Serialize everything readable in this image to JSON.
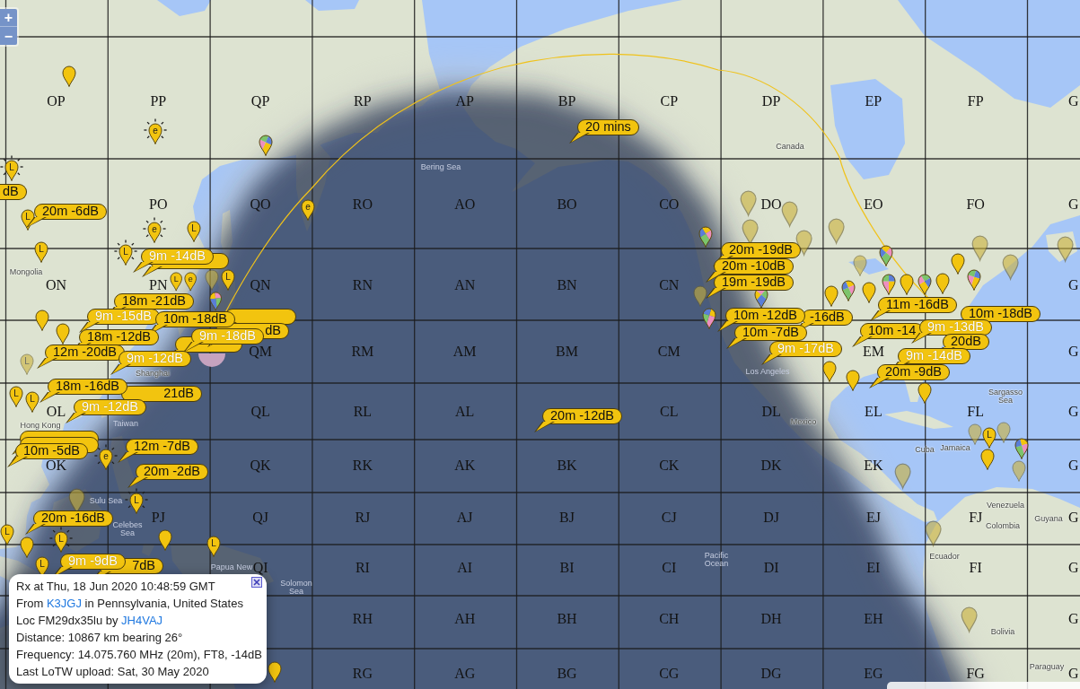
{
  "zoom_controls": [
    {
      "label": "+"
    },
    {
      "label": "−"
    }
  ],
  "grid_labels": [
    "OP",
    "PP",
    "QP",
    "RP",
    "AP",
    "BP",
    "CP",
    "DP",
    "EP",
    "FP",
    "G",
    "PO",
    "QO",
    "RO",
    "AO",
    "BO",
    "CO",
    "DO",
    "EO",
    "FO",
    "G",
    "ON",
    "PN",
    "QN",
    "RN",
    "AN",
    "BN",
    "CN",
    "G",
    "QM",
    "RM",
    "AM",
    "BM",
    "CM",
    "EM",
    "G",
    "OL",
    "QL",
    "RL",
    "AL",
    "CL",
    "DL",
    "EL",
    "FL",
    "G",
    "OK",
    "QK",
    "RK",
    "AK",
    "BK",
    "CK",
    "DK",
    "EK",
    "G",
    "PJ",
    "QJ",
    "RJ",
    "AJ",
    "BJ",
    "CJ",
    "DJ",
    "EJ",
    "FJ",
    "G",
    "QI",
    "RI",
    "AI",
    "BI",
    "CI",
    "DI",
    "EI",
    "FI",
    "G",
    "RH",
    "AH",
    "BH",
    "CH",
    "DH",
    "EH",
    "G",
    "RG",
    "AG",
    "BG",
    "CG",
    "DG",
    "EG",
    "FG",
    "G"
  ],
  "map_labels": [
    "Canada",
    "Bering Sea",
    "Mongolia",
    "Shanghai",
    "Los Angeles",
    "Sargasso Sea",
    "Hong Kong",
    "Taiwan",
    "Mexico",
    "Cuba",
    "Jamaica",
    "Sulu Sea",
    "Venezuela",
    "Celebes Sea",
    "Colombia",
    "Guyana",
    "Pacific Ocean",
    "Ecuador",
    "Papua New",
    "Solomon Sea",
    "Bolivia",
    "Paraguay"
  ],
  "markers": [
    {
      "kind": "pin",
      "faded": false
    },
    {
      "kind": "sun",
      "letter": "e",
      "faded": false
    },
    {
      "kind": "pie",
      "faded": false
    },
    {
      "kind": "sun",
      "letter": "L",
      "faded": false
    },
    {
      "kind": "pin",
      "faded": true
    },
    {
      "kind": "letter",
      "letter": "e",
      "faded": false
    },
    {
      "kind": "pin",
      "faded": true
    },
    {
      "kind": "letter",
      "letter": "L",
      "faded": false
    },
    {
      "kind": "sun",
      "letter": "e",
      "faded": false
    },
    {
      "kind": "letter",
      "letter": "L",
      "faded": false
    },
    {
      "kind": "pin",
      "faded": true
    },
    {
      "kind": "pin",
      "faded": true
    },
    {
      "kind": "pie",
      "faded": false
    },
    {
      "kind": "pin",
      "faded": true
    },
    {
      "kind": "pin",
      "faded": true
    },
    {
      "kind": "pin",
      "faded": true
    },
    {
      "kind": "letter",
      "letter": "L",
      "faded": false
    },
    {
      "kind": "sun",
      "letter": "L",
      "faded": false
    },
    {
      "kind": "pie",
      "faded": false
    },
    {
      "kind": "pin",
      "faded": true
    },
    {
      "kind": "pin",
      "faded": false
    },
    {
      "kind": "pin",
      "faded": true
    },
    {
      "kind": "letter",
      "letter": "L",
      "faded": false
    },
    {
      "kind": "letter",
      "letter": "e",
      "faded": false
    },
    {
      "kind": "pin",
      "faded": true
    },
    {
      "kind": "letter",
      "letter": "L",
      "faded": false
    },
    {
      "kind": "pin",
      "faded": false
    },
    {
      "kind": "pie",
      "faded": false
    },
    {
      "kind": "pin",
      "faded": true
    },
    {
      "kind": "pie",
      "faded": false
    },
    {
      "kind": "pin",
      "faded": false
    },
    {
      "kind": "pie",
      "faded": false
    },
    {
      "kind": "pin",
      "faded": false
    },
    {
      "kind": "pie",
      "faded": false
    },
    {
      "kind": "pie",
      "faded": false
    },
    {
      "kind": "pin",
      "faded": false
    },
    {
      "kind": "pie",
      "faded": false
    },
    {
      "kind": "pin",
      "faded": false
    },
    {
      "kind": "pie",
      "faded": false
    },
    {
      "kind": "pin",
      "faded": false
    },
    {
      "kind": "letter",
      "letter": "L",
      "faded": true
    },
    {
      "kind": "sector",
      "faded": false
    },
    {
      "kind": "pin",
      "faded": false
    },
    {
      "kind": "pin",
      "faded": false
    },
    {
      "kind": "letter",
      "letter": "L",
      "faded": false
    },
    {
      "kind": "letter",
      "letter": "L",
      "faded": false
    },
    {
      "kind": "pin",
      "faded": false
    },
    {
      "kind": "pin",
      "faded": true
    },
    {
      "kind": "letter",
      "letter": "L",
      "faded": false
    },
    {
      "kind": "pin",
      "faded": true
    },
    {
      "kind": "pie",
      "faded": false
    },
    {
      "kind": "sun",
      "letter": "e",
      "faded": false
    },
    {
      "kind": "pin",
      "faded": false
    },
    {
      "kind": "pin",
      "faded": true
    },
    {
      "kind": "pin",
      "faded": true
    },
    {
      "kind": "pin",
      "faded": true
    },
    {
      "kind": "sun",
      "letter": "L",
      "faded": false
    },
    {
      "kind": "letter",
      "letter": "L",
      "faded": false
    },
    {
      "kind": "pin",
      "faded": false
    },
    {
      "kind": "sun",
      "letter": "L",
      "faded": false
    },
    {
      "kind": "pin",
      "faded": false
    },
    {
      "kind": "letter",
      "letter": "L",
      "faded": false
    },
    {
      "kind": "pin",
      "faded": true
    },
    {
      "kind": "letter",
      "letter": "L",
      "faded": false
    },
    {
      "kind": "pin",
      "faded": true
    },
    {
      "kind": "pin",
      "faded": false
    }
  ],
  "reports": [
    {
      "kind": "label",
      "text": "20 mins",
      "light_text": false
    },
    {
      "kind": "label",
      "text": "dB",
      "light_text": false
    },
    {
      "kind": "label",
      "text": "20m -6dB",
      "light_text": false
    },
    {
      "kind": "label",
      "text": "9m -14dB",
      "light_text": true
    },
    {
      "kind": "covered"
    },
    {
      "kind": "label",
      "text": "20m -19dB",
      "light_text": false
    },
    {
      "kind": "label",
      "text": "20m -10dB",
      "light_text": false
    },
    {
      "kind": "label",
      "text": "19m -19dB",
      "light_text": false
    },
    {
      "kind": "label",
      "text": "18m -21dB",
      "light_text": false
    },
    {
      "kind": "label",
      "text": "11m -16dB",
      "light_text": false
    },
    {
      "kind": "label",
      "text": "9m -15dB",
      "light_text": true
    },
    {
      "kind": "label",
      "text": "10m -18dB",
      "light_text": false
    },
    {
      "kind": "covered"
    },
    {
      "kind": "label",
      "text": "10m -12dB",
      "light_text": false
    },
    {
      "kind": "label",
      "text": "-16dB",
      "light_text": false
    },
    {
      "kind": "label",
      "text": "10m -18dB",
      "light_text": false
    },
    {
      "kind": "label",
      "text": "18m -12dB",
      "light_text": false
    },
    {
      "kind": "label",
      "text": "9m -18dB",
      "light_text": true
    },
    {
      "kind": "label",
      "text": "dB",
      "light_text": false
    },
    {
      "kind": "label",
      "text": "10m -7dB",
      "light_text": false
    },
    {
      "kind": "label",
      "text": "10m -14",
      "light_text": false
    },
    {
      "kind": "label",
      "text": "9m -13dB",
      "light_text": true
    },
    {
      "kind": "covered"
    },
    {
      "kind": "label",
      "text": "9m -17dB",
      "light_text": true
    },
    {
      "kind": "label",
      "text": "20dB",
      "light_text": false
    },
    {
      "kind": "label",
      "text": "12m -20dB",
      "light_text": false
    },
    {
      "kind": "label",
      "text": "9m -12dB",
      "light_text": true
    },
    {
      "kind": "label",
      "text": "9m -14dB",
      "light_text": true
    },
    {
      "kind": "label",
      "text": "20m -9dB",
      "light_text": false
    },
    {
      "kind": "label",
      "text": "18m -16dB",
      "light_text": false
    },
    {
      "kind": "label",
      "text": "21dB",
      "light_text": false
    },
    {
      "kind": "label",
      "text": "9m -12dB",
      "light_text": true
    },
    {
      "kind": "label",
      "text": "20m -12dB",
      "light_text": false
    },
    {
      "kind": "label",
      "text": "10m -5dB",
      "light_text": false
    },
    {
      "kind": "covered"
    },
    {
      "kind": "covered"
    },
    {
      "kind": "label",
      "text": "12m -7dB",
      "light_text": false
    },
    {
      "kind": "label",
      "text": "20m -2dB",
      "light_text": false
    },
    {
      "kind": "label",
      "text": "20m -16dB",
      "light_text": false
    },
    {
      "kind": "label",
      "text": "9m -9dB",
      "light_text": true
    },
    {
      "kind": "label",
      "text": "7dB",
      "light_text": false
    }
  ],
  "info_popup": {
    "lines": [
      {
        "parts": [
          {
            "text": "Rx at Thu, 18 Jun 2020 10:48:59 GMT",
            "link": false
          }
        ]
      },
      {
        "parts": [
          {
            "text": "From ",
            "link": false
          },
          {
            "text": "K3JGJ",
            "link": true
          },
          {
            "text": " in Pennsylvania, United States",
            "link": false
          }
        ]
      },
      {
        "parts": [
          {
            "text": "Loc FM29dx35lu by ",
            "link": false
          },
          {
            "text": "JH4VAJ",
            "link": true
          }
        ]
      },
      {
        "parts": [
          {
            "text": "Distance: 10867 km bearing 26°",
            "link": false
          }
        ]
      },
      {
        "parts": [
          {
            "text": "Frequency: 14.075.760 MHz (20m), FT8, -14dB",
            "link": false
          }
        ]
      },
      {
        "parts": [
          {
            "text": "Last LoTW upload: Sat, 30 May 2020",
            "link": false
          }
        ]
      }
    ]
  }
}
